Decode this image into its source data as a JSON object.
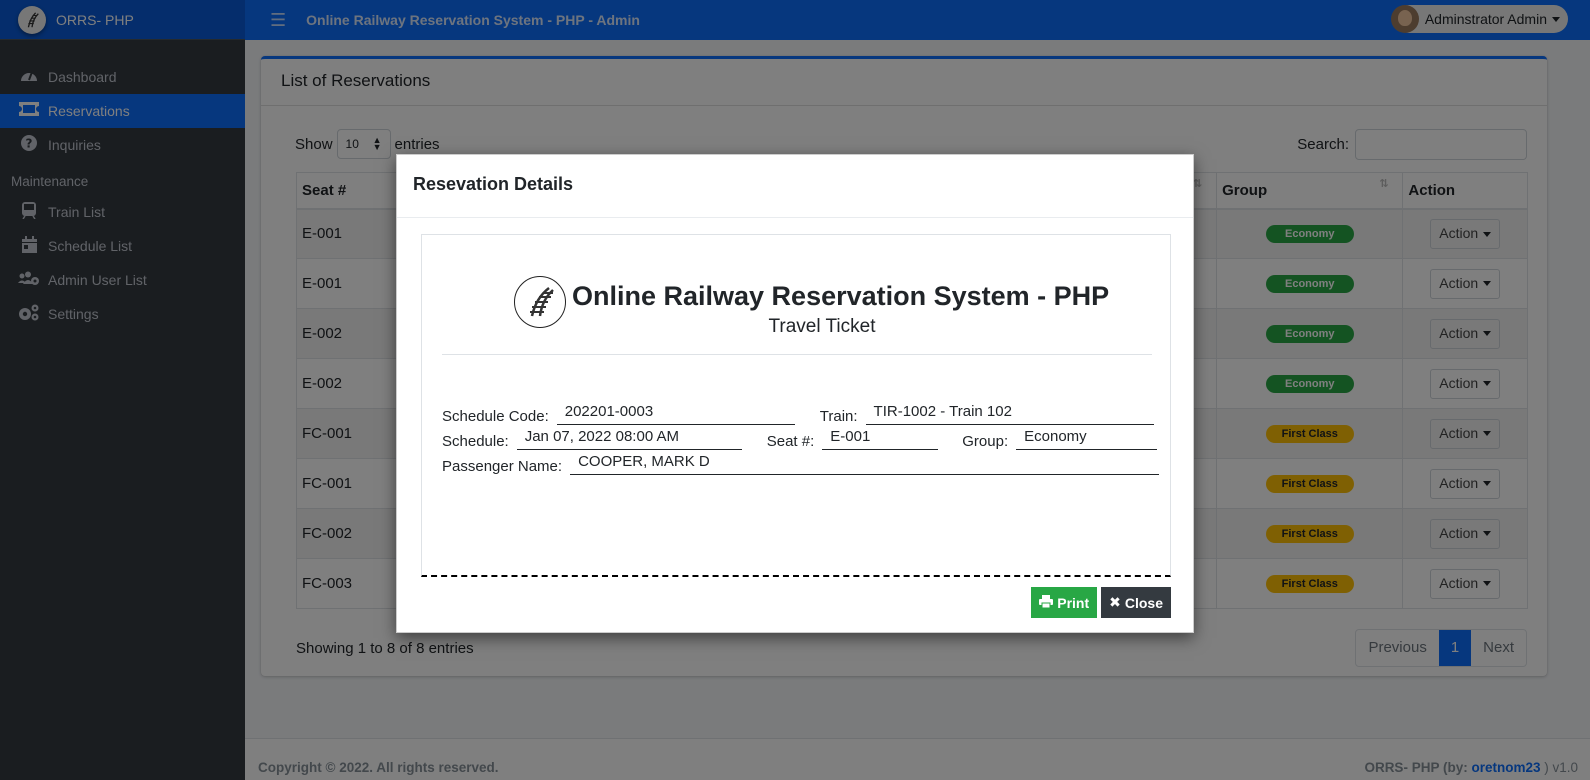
{
  "brand": {
    "name": "ORRS- PHP"
  },
  "topbar": {
    "title": "Online Railway Reservation System - PHP - Admin",
    "user": "Adminstrator Admin"
  },
  "sidebar": {
    "items": [
      {
        "label": "Dashboard",
        "icon": "tachometer-icon",
        "active": false
      },
      {
        "label": "Reservations",
        "icon": "ticket-icon",
        "active": true
      },
      {
        "label": "Inquiries",
        "icon": "question-circle-icon",
        "active": false
      }
    ],
    "section_header": "Maintenance",
    "maintenance_items": [
      {
        "label": "Train List",
        "icon": "train-icon"
      },
      {
        "label": "Schedule List",
        "icon": "calendar-icon"
      },
      {
        "label": "Admin User List",
        "icon": "users-cog-icon"
      },
      {
        "label": "Settings",
        "icon": "cogs-icon"
      }
    ]
  },
  "card": {
    "title": "List of Reservations",
    "show_label": "Show",
    "entries_label": "entries",
    "page_length": "10",
    "search_label": "Search:",
    "search_value": "",
    "columns": [
      "Seat #",
      "Group",
      "Action"
    ],
    "rows": [
      {
        "seat": "E-001",
        "group": "Economy",
        "action": "Action"
      },
      {
        "seat": "E-001",
        "group": "Economy",
        "action": "Action"
      },
      {
        "seat": "E-002",
        "group": "Economy",
        "action": "Action"
      },
      {
        "seat": "E-002",
        "group": "Economy",
        "action": "Action"
      },
      {
        "seat": "FC-001",
        "group": "First Class",
        "action": "Action"
      },
      {
        "seat": "FC-001",
        "group": "First Class",
        "action": "Action"
      },
      {
        "seat": "FC-002",
        "group": "First Class",
        "action": "Action"
      },
      {
        "seat": "FC-003",
        "group": "First Class",
        "action": "Action"
      }
    ],
    "info": "Showing 1 to 8 of 8 entries",
    "pager": {
      "previous": "Previous",
      "current": "1",
      "next": "Next"
    }
  },
  "footer": {
    "copyright": "Copyright © 2022. All rights reserved.",
    "credit_prefix": "ORRS- PHP (by: ",
    "credit_link": "oretnom23",
    "credit_suffix": " ) v1.0"
  },
  "modal": {
    "title": "Resevation Details",
    "ticket": {
      "system_name": "Online Railway Reservation System - PHP",
      "subtitle": "Travel Ticket",
      "schedule_code_label": "Schedule Code:",
      "schedule_code": "202201-0003",
      "train_label": "Train:",
      "train": "TIR-1002 - Train 102",
      "schedule_label": "Schedule:",
      "schedule": "Jan 07, 2022 08:00 AM",
      "seat_label": "Seat #:",
      "seat": "E-001",
      "group_label": "Group:",
      "group": "Economy",
      "passenger_label": "Passenger Name:",
      "passenger": "COOPER, MARK D"
    },
    "print_label": "Print",
    "close_label": "Close"
  },
  "colors": {
    "primary": "#0d6efd",
    "success": "#28a745",
    "warning": "#ffc107",
    "dark": "#343a40"
  }
}
